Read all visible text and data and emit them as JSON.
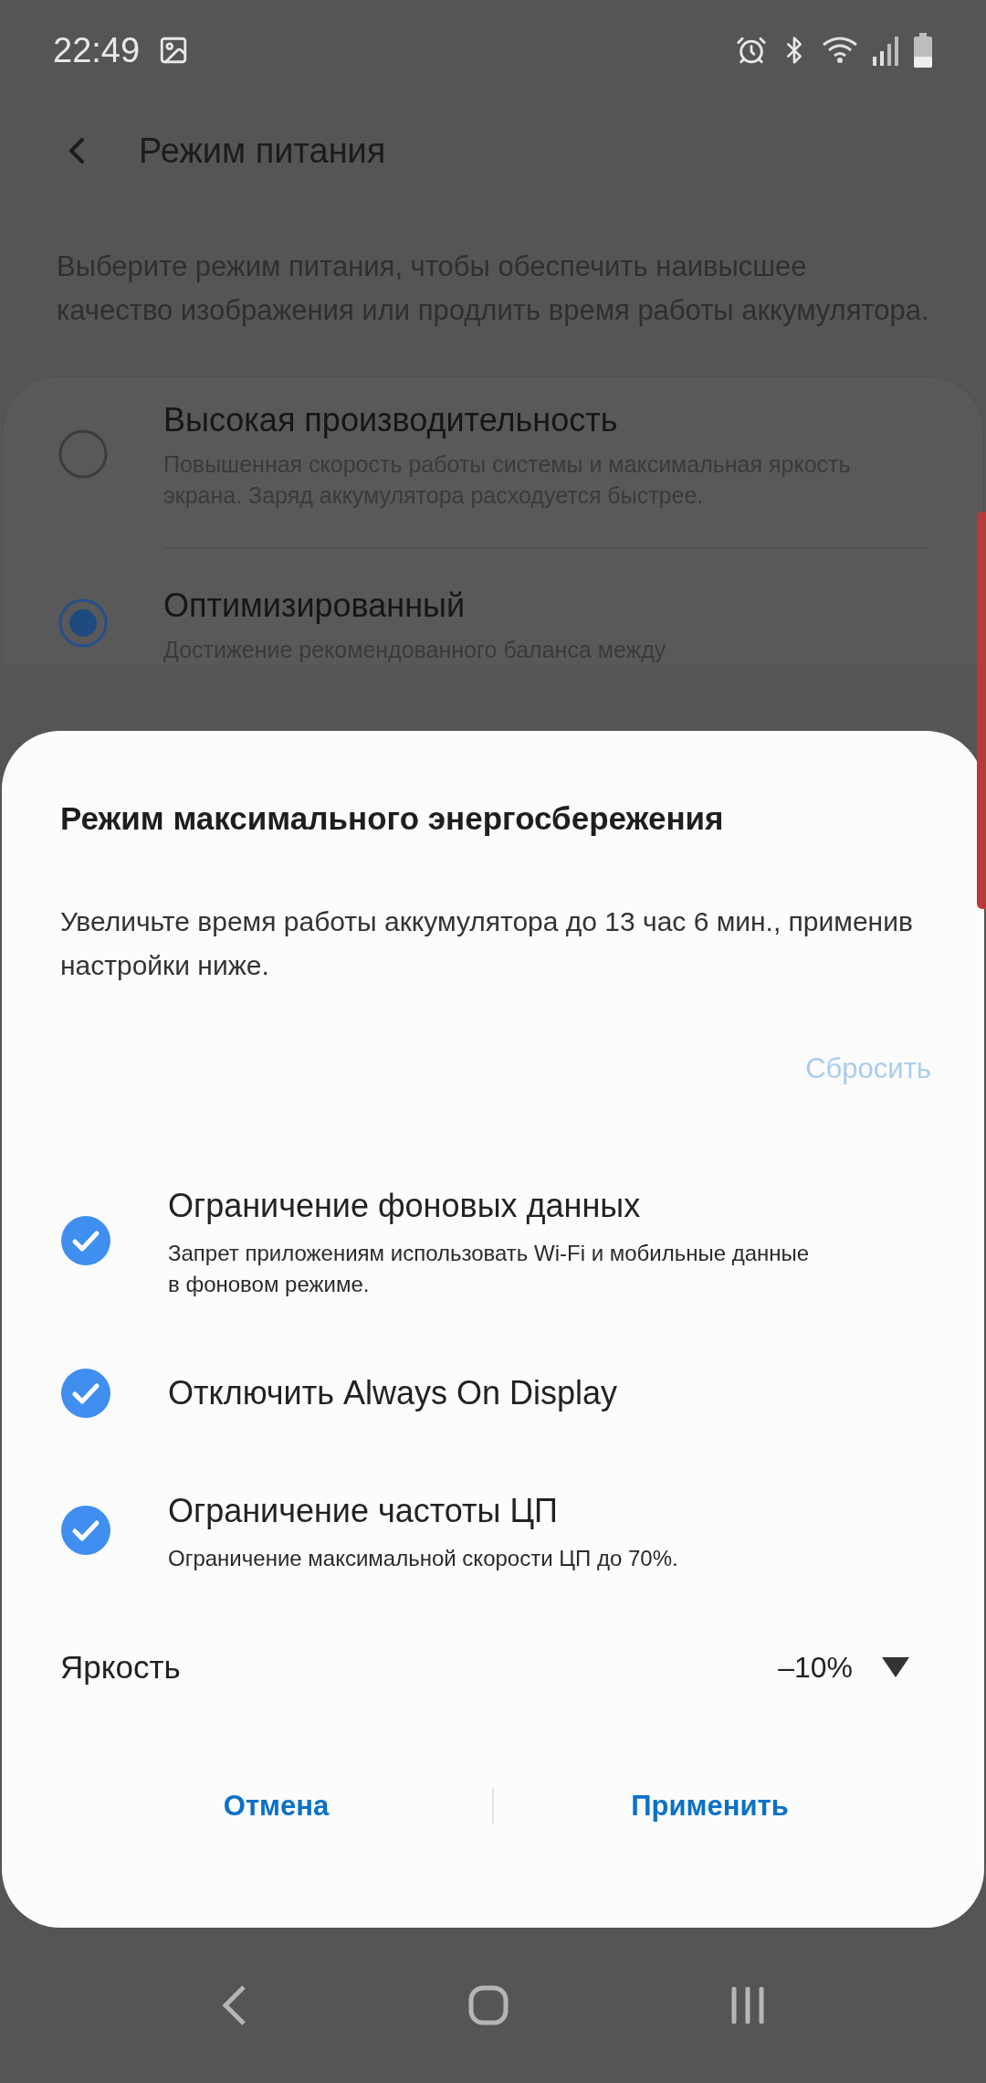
{
  "status_bar": {
    "time": "22:49"
  },
  "header": {
    "title": "Режим питания"
  },
  "intro": "Выберите режим питания, чтобы обеспечить наивысшее качество изображения или продлить время работы аккумулятора.",
  "power_modes": [
    {
      "title": "Высокая производительность",
      "description": "Повышенная скорость работы системы и максимальная яркость экрана. Заряд аккумулятора расходуется быстрее.",
      "selected": false
    },
    {
      "title": "Оптимизированный",
      "description": "Достижение рекомендованного баланса между",
      "selected": true
    }
  ],
  "dialog": {
    "title": "Режим максимального энергосбережения",
    "message": "Увеличьте время работы аккумулятора до 13 час 6 мин., применив настройки ниже.",
    "reset_button": {
      "label": "Сбросить",
      "disabled": true
    },
    "options": [
      {
        "title": "Ограничение фоновых данных",
        "description": "Запрет приложениям использовать Wi-Fi и мобильные данные в фоновом режиме.",
        "checked": true
      },
      {
        "title": "Отключить Always On Display",
        "checked": true
      },
      {
        "title": "Ограничение частоты ЦП",
        "description": "Ограничение максимальной скорости ЦП до 70%.",
        "checked": true
      }
    ],
    "brightness": {
      "label": "Яркость",
      "value": "–10%"
    },
    "buttons": [
      {
        "label": "Отмена"
      },
      {
        "label": "Применить"
      }
    ]
  }
}
